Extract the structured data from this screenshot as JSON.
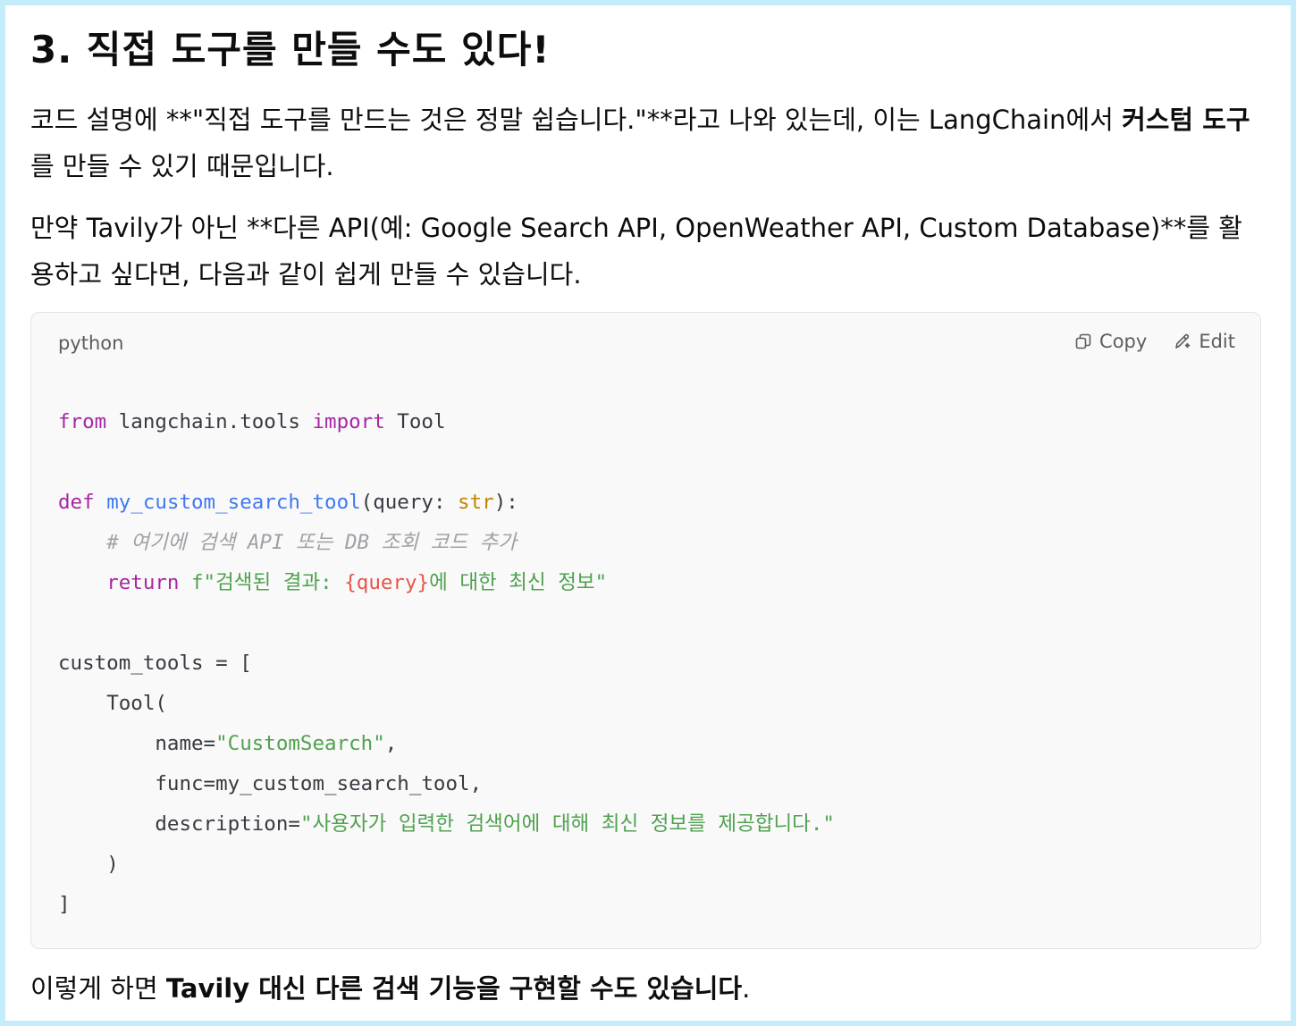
{
  "heading": "3. 직접 도구를 만들 수도 있다!",
  "para1": {
    "text_a": "코드 설명에 **\"직접 도구를 만드는 것은 정말 쉽습니다.\"**라고 나와 있는데, 이는 LangChain에서 ",
    "bold": "커스텀 도구",
    "text_b": "를 만들 수 있기 때문입니다."
  },
  "para2": "만약 Tavily가 아닌 **다른 API(예: Google Search API, OpenWeather API, Custom Database)**를 활용하고 싶다면, 다음과 같이 쉽게 만들 수 있습니다.",
  "codeblock": {
    "language": "python",
    "copy_label": "Copy",
    "edit_label": "Edit",
    "copy_icon": "copy-icon",
    "edit_icon": "pencil-edit-icon",
    "tokens": {
      "from": "from",
      "mod": " langchain.tools ",
      "import": "import",
      "tool_cls": " Tool",
      "def": "def",
      "fname": "my_custom_search_tool",
      "params_a": "(query: ",
      "str_type": "str",
      "params_b": "):",
      "comment": "# 여기에 검색 API 또는 DB 조회 코드 추가",
      "return": "return",
      "fstr_a": "f\"검색된 결과: ",
      "interp": "{query}",
      "fstr_b": "에 대한 최신 정보\"",
      "assign": "custom_tools = [",
      "tool_call": "Tool(",
      "name_kw": "name=",
      "name_val": "\"CustomSearch\"",
      "comma": ",",
      "func_line": "func=my_custom_search_tool,",
      "desc_kw": "description=",
      "desc_val": "\"사용자가 입력한 검색어에 대해 최신 정보를 제공합니다.\"",
      "close_paren": ")",
      "close_bracket": "]"
    }
  },
  "para3": {
    "text_a": "이렇게 하면 ",
    "bold": "Tavily 대신 다른 검색 기능을 구현할 수도 있습니다",
    "text_b": "."
  },
  "colors": {
    "frame_border": "#c5ecfb",
    "code_bg": "#f9f9f9",
    "keyword": "#a626a4",
    "function": "#4078f2",
    "builtin": "#c18401",
    "string": "#50a14f",
    "comment": "#a0a1a7",
    "interpolation": "#e45649"
  }
}
